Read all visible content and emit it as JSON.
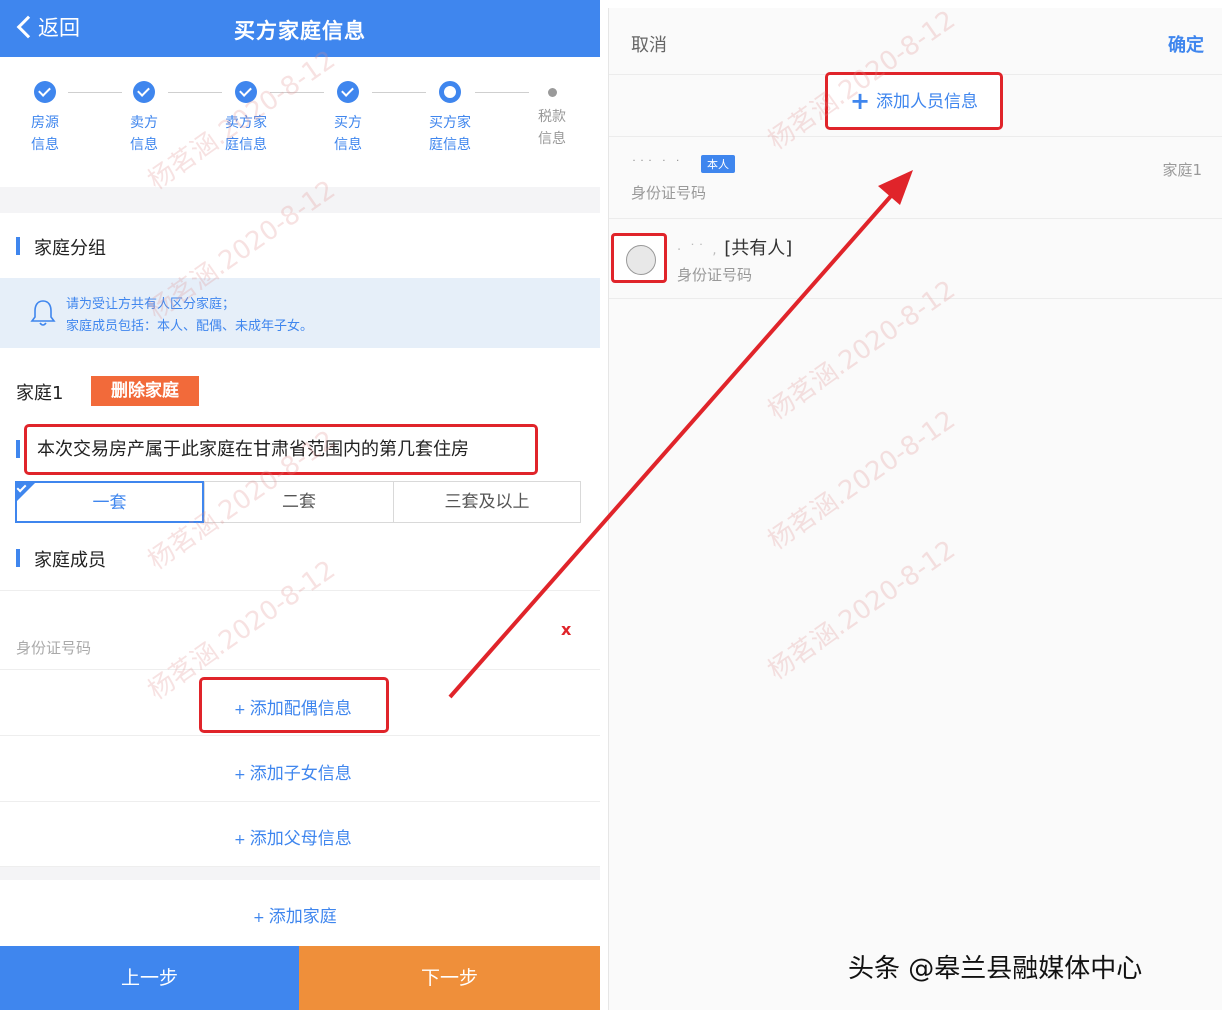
{
  "header": {
    "back_label": "返回",
    "title": "买方家庭信息"
  },
  "steps": [
    {
      "line1": "房源",
      "line2": "信息",
      "state": "done"
    },
    {
      "line1": "卖方",
      "line2": "信息",
      "state": "done"
    },
    {
      "line1": "卖方家",
      "line2": "庭信息",
      "state": "done"
    },
    {
      "line1": "买方",
      "line2": "信息",
      "state": "done"
    },
    {
      "line1": "买方家",
      "line2": "庭信息",
      "state": "current"
    },
    {
      "line1": "税款",
      "line2": "信息",
      "state": "todo"
    }
  ],
  "family_group": {
    "title": "家庭分组",
    "notice_line1": "请为受让方共有人区分家庭；",
    "notice_line2": "家庭成员包括：本人、配偶、未成年子女。"
  },
  "family": {
    "label": "家庭1",
    "delete_label": "删除家庭",
    "question": "本次交易房产属于此家庭在甘肃省范围内的第几套住房",
    "options": [
      "一套",
      "二套",
      "三套及以上"
    ],
    "selected_option": "一套"
  },
  "members": {
    "title": "家庭成员",
    "member_id_label": "身份证号码",
    "remove_label": "x",
    "add_spouse": "添加配偶信息",
    "add_child": "添加子女信息",
    "add_parent": "添加父母信息",
    "add_family": "添加家庭"
  },
  "nav": {
    "prev": "上一步",
    "next": "下一步"
  },
  "picker": {
    "cancel": "取消",
    "confirm": "确定",
    "add_person": "添加人员信息",
    "person1": {
      "badge": "本人",
      "id_label": "身份证号码",
      "family": "家庭1"
    },
    "person2": {
      "role": "[共有人]",
      "id_label": "身份证号码"
    }
  },
  "footer_credit": "头条 @皋兰县融媒体中心",
  "watermark": "杨茗涵.2020-8-12",
  "colors": {
    "primary": "#3f86ee",
    "orange": "#ef8f3a",
    "danger": "#e0242a",
    "delete": "#f26a3a"
  }
}
